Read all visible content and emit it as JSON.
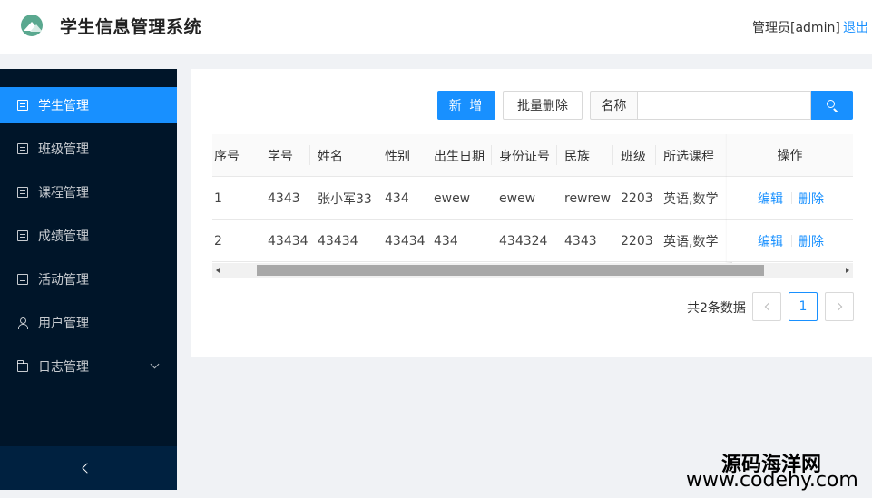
{
  "app": {
    "title": "学生信息管理系统"
  },
  "header": {
    "user": "管理员[admin]",
    "logout": "退出"
  },
  "sidebar": {
    "items": [
      {
        "label": "学生管理",
        "icon": "file-list-icon",
        "active": true
      },
      {
        "label": "班级管理",
        "icon": "file-list-icon"
      },
      {
        "label": "课程管理",
        "icon": "file-list-icon"
      },
      {
        "label": "成绩管理",
        "icon": "file-list-icon"
      },
      {
        "label": "活动管理",
        "icon": "file-list-icon"
      },
      {
        "label": "用户管理",
        "icon": "user-icon"
      },
      {
        "label": "日志管理",
        "icon": "folder-icon"
      }
    ]
  },
  "toolbar": {
    "add_label": "新 增",
    "batch_delete_label": "批量删除",
    "search_addon": "名称",
    "search_value": ""
  },
  "table": {
    "columns": [
      "序号",
      "学号",
      "姓名",
      "性别",
      "出生日期",
      "身份证号",
      "民族",
      "班级",
      "所选课程",
      "操作"
    ],
    "rows": [
      [
        "1",
        "4343",
        "张小军33",
        "434",
        "ewew",
        "ewew",
        "rewrew",
        "2203",
        "英语,数学"
      ],
      [
        "2",
        "43434",
        "43434",
        "43434",
        "434",
        "434324",
        "4343",
        "2203",
        "英语,数学"
      ]
    ],
    "actions": {
      "edit": "编辑",
      "delete": "删除"
    }
  },
  "pagination": {
    "total": "共2条数据",
    "current": "1"
  },
  "watermark": {
    "cn": "源码海洋网",
    "url": "www.codehy.com"
  },
  "colors": {
    "primary": "#1890ff",
    "sidebar": "#001529",
    "sidebar_bottom": "#002140"
  }
}
